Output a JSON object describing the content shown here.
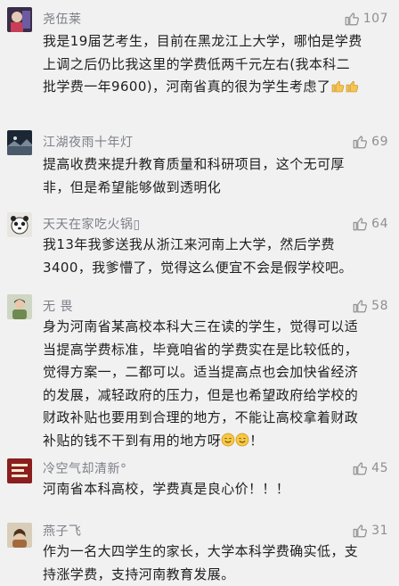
{
  "comments": [
    {
      "name": "尧伍莱",
      "likes": "107",
      "lines": [
        "我是19届艺考生，目前在黑龙江上大学，哪怕是学费",
        "上调之后仍比我这里的学费低两千元左右(我本科二",
        "批学费一年9600)，河南省真的很为学生考虑了"
      ],
      "trailing_icons": [
        "thumbs-up-emoji-icon",
        "thumbs-up-emoji-icon"
      ]
    },
    {
      "name": "江湖夜雨十年灯",
      "likes": "69",
      "lines": [
        "提高收费来提升教育质量和科研项目，这个无可厚",
        "非，但是希望能够做到透明化"
      ]
    },
    {
      "name": "天天在家吃火锅▯",
      "likes": "64",
      "lines": [
        "我13年我爹送我从浙江来河南上大学，然后学费",
        "3400，我爹懵了，觉得这么便宜不会是假学校吧。"
      ]
    },
    {
      "name": "无 畏",
      "likes": "58",
      "lines": [
        "身为河南省某高校本科大三在读的学生，觉得可以适",
        "当提高学费标准，毕竟咱省的学费实在是比较低的，",
        "觉得方案一，二都可以。适当提高点也会加快省经济",
        "的发展，减轻政府的压力，但是也希望政府给学校的",
        "财政补贴也要用到合理的地方，不能让高校拿着财政",
        "补贴的钱不干到有用的地方呀"
      ],
      "trailing_icons": [
        "smile-emoji-icon",
        "smile-emoji-icon"
      ],
      "trailing_text": "！"
    },
    {
      "name": "冷空气却清新°",
      "likes": "45",
      "lines": [
        "河南省本科高校，学费真是良心价！！！"
      ]
    },
    {
      "name": "燕子飞",
      "likes": "31",
      "lines": [
        "作为一名大四学生的家长，大学本科学费确实低，支",
        "持涨学费，支持河南教育发展。"
      ]
    }
  ],
  "colors": {
    "background": "#f1f1f1",
    "name": "#7d8089",
    "text": "#1e1e1e",
    "like": "#8f8f8f"
  }
}
